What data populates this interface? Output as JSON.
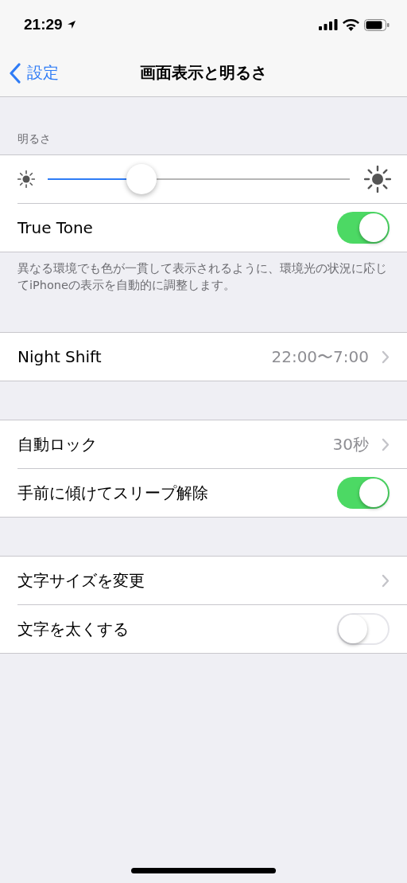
{
  "status_bar": {
    "time": "21:29"
  },
  "nav": {
    "back": "設定",
    "title": "画面表示と明るさ"
  },
  "sections": [
    {
      "header": "明るさ",
      "rows": [
        {
          "kind": "slider",
          "level": 0.29
        },
        {
          "kind": "toggle",
          "label": "True Tone",
          "on": true
        }
      ],
      "footer": "異なる環境でも色が一貫して表示されるように、環境光の状況に応じてiPhoneの表示を自動的に調整します。"
    },
    {
      "rows": [
        {
          "kind": "disclosure",
          "label": "Night Shift",
          "value": "22:00〜7:00"
        }
      ]
    },
    {
      "rows": [
        {
          "kind": "disclosure",
          "label": "自動ロック",
          "value": "30秒"
        },
        {
          "kind": "toggle",
          "label": "手前に傾けてスリープ解除",
          "on": true
        }
      ]
    },
    {
      "rows": [
        {
          "kind": "disclosure",
          "label": "文字サイズを変更"
        },
        {
          "kind": "toggle",
          "label": "文字を太くする",
          "on": false
        }
      ]
    }
  ]
}
